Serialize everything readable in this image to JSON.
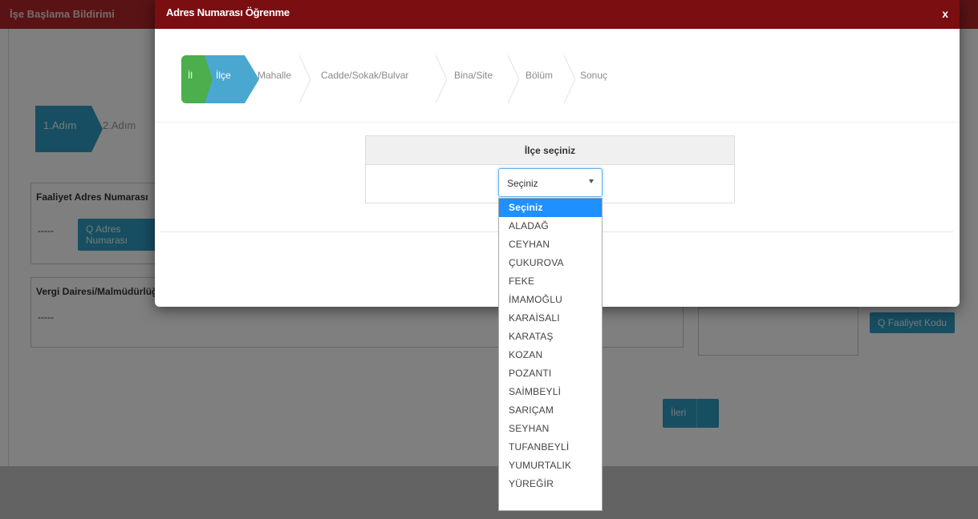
{
  "page": {
    "header_title": "İşe Başlama Bildirimi",
    "steps": [
      "1.Adım",
      "2.Adım"
    ],
    "faaliyet_label": "Faaliyet Adres Numarası",
    "faaliyet_value": "-----",
    "address_btn": "Adres Numarası",
    "vergi_label": "Vergi Dairesi/Malmüdürlüğü",
    "vergi_value": "-----",
    "next_btn": "İleri",
    "faaliyet_kodu_btn": "Faaliyet Kodu"
  },
  "modal": {
    "title": "Adres Numarası Öğrenme",
    "close": "x",
    "wizard": {
      "steps": [
        "İl",
        "İlçe",
        "Mahalle",
        "Cadde/Sokak/Bulvar",
        "Bina/Site",
        "Bölüm",
        "Sonuç"
      ],
      "active_index": 1
    },
    "panel_title": "İlçe seçiniz",
    "select_value": "Seçiniz",
    "options": [
      "Seçiniz",
      "ALADAĞ",
      "CEYHAN",
      "ÇUKUROVA",
      "FEKE",
      "İMAMOĞLU",
      "KARAİSALI",
      "KARATAŞ",
      "KOZAN",
      "POZANTI",
      "SAİMBEYLİ",
      "SARIÇAM",
      "SEYHAN",
      "TUFANBEYLİ",
      "YUMURTALIK",
      "YÜREĞİR"
    ],
    "selected_option_index": 0
  },
  "colors": {
    "header": "#b3262b",
    "modal_header": "#7a0e11",
    "step_done": "#4cae4c",
    "step_active": "#4aa8d0",
    "option_highlight": "#1e90ff"
  }
}
